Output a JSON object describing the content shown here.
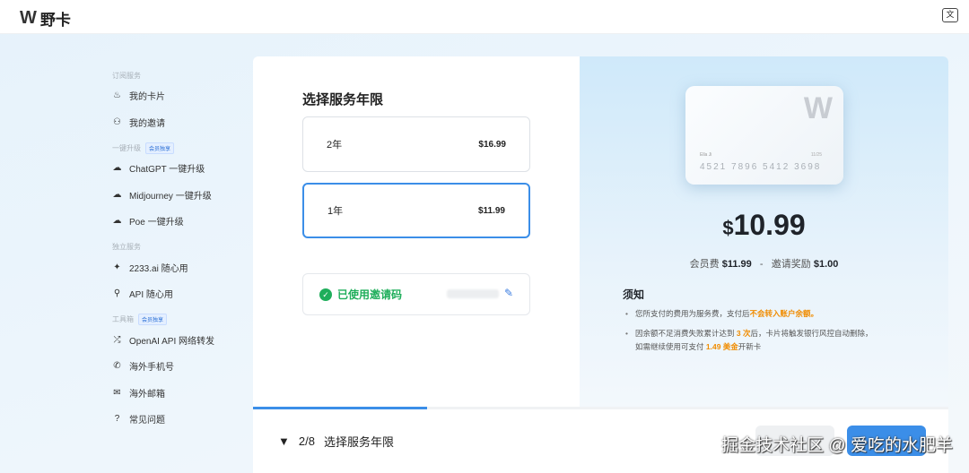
{
  "header": {
    "logo_mark": "W",
    "title": "野卡",
    "lang_icon": "translate-icon"
  },
  "sidebar": {
    "sections": [
      {
        "label": "订阅服务",
        "items": [
          {
            "label": "我的卡片",
            "icon": "card-hand-icon"
          },
          {
            "label": "我的邀请",
            "icon": "users-icon"
          }
        ]
      },
      {
        "label": "一键升级",
        "badge": "会员独享",
        "items": [
          {
            "label": "ChatGPT 一键升级",
            "icon": "cloud-upload-icon"
          },
          {
            "label": "Midjourney 一键升级",
            "icon": "cloud-upload-icon"
          },
          {
            "label": "Poe 一键升级",
            "icon": "cloud-upload-icon"
          }
        ]
      },
      {
        "label": "独立服务",
        "items": [
          {
            "label": "2233.ai 随心用",
            "icon": "sparkle-icon"
          },
          {
            "label": "API 随心用",
            "icon": "plug-icon"
          }
        ]
      },
      {
        "label": "工具箱",
        "badge": "会员独享",
        "items": [
          {
            "label": "OpenAI API 网络转发",
            "icon": "shuffle-icon"
          },
          {
            "label": "海外手机号",
            "icon": "phone-icon"
          },
          {
            "label": "海外邮箱",
            "icon": "mail-icon"
          },
          {
            "label": "常见问题",
            "icon": "help-icon"
          }
        ]
      }
    ]
  },
  "form": {
    "title": "选择服务年限",
    "options": [
      {
        "label": "2年",
        "price": "$16.99",
        "selected": false
      },
      {
        "label": "1年",
        "price": "$11.99",
        "selected": true
      }
    ],
    "invite_status": "已使用邀请码"
  },
  "summary": {
    "card": {
      "logo": "W",
      "holder": "Ella Ji",
      "expiry": "11/25",
      "number": "4521 7896 5412 3698"
    },
    "currency": "$",
    "total": "10.99",
    "fee_label": "会员费",
    "fee": "$11.99",
    "separator": "-",
    "reward_label": "邀请奖励",
    "reward": "$1.00",
    "notice_title": "须知",
    "notice1_a": "您所支付的费用为服务费，支付后",
    "notice1_b": "不会转入账户余额。",
    "notice2_a": "因余额不足消费失败累计达到 ",
    "notice2_b": "3 次",
    "notice2_c": "后，卡片将触发银行风控自动删除，",
    "notice2_d": "如需继续使用可支付 ",
    "notice2_e": "1.49 美金",
    "notice2_f": "开新卡"
  },
  "footer": {
    "step": "2/8",
    "step_title": "选择服务年限",
    "progress": 0.25
  },
  "watermark": "掘金技术社区 @ 爱吃的水肥羊"
}
